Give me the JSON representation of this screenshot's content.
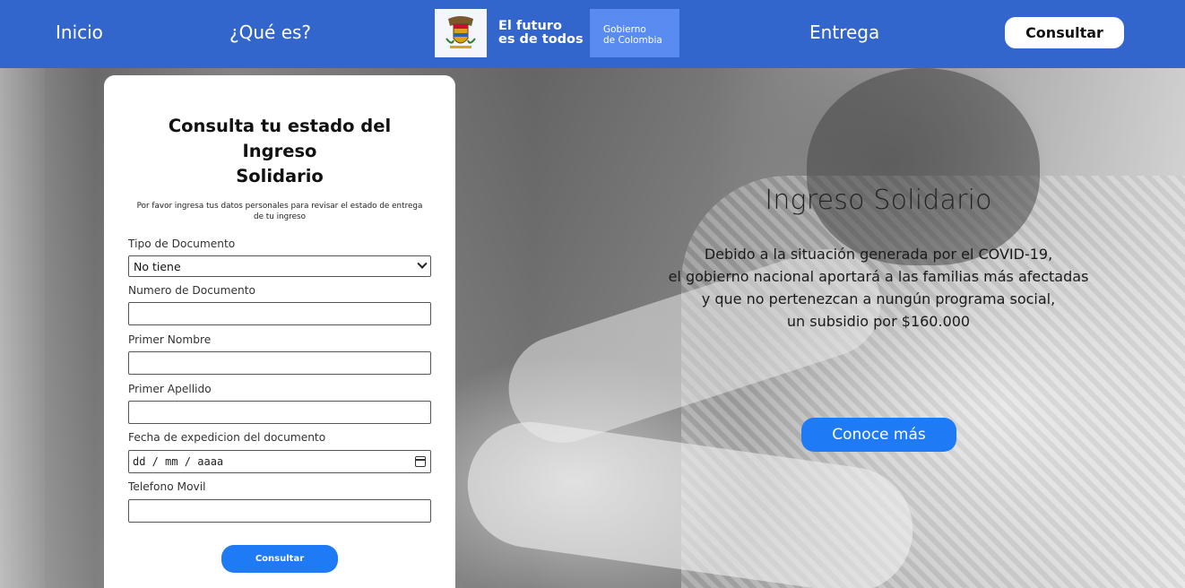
{
  "header": {
    "nav": {
      "inicio": "Inicio",
      "que_es": "¿Qué es?",
      "entrega": "Entrega"
    },
    "logo": {
      "slogan_line1": "El futuro",
      "slogan_line2": "es de todos",
      "gov_line1": "Gobierno",
      "gov_line2": "de Colombia"
    },
    "consultar_button": "Consultar",
    "bar_color": "#3366cc"
  },
  "hero": {
    "title": "Ingreso Solidario",
    "lines": [
      "Debido a la situación generada por el COVID-19,",
      "el gobierno nacional aportará a las familias más afectadas",
      "y que no pertenezcan a nungún programa social,",
      "un subsidio por $160.000"
    ],
    "cta_button": "Conoce más",
    "accent_color": "#1e7bf5"
  },
  "form": {
    "title_line1": "Consulta tu estado del",
    "title_line2": "Ingreso",
    "title_line3": "Solidario",
    "description": "Por favor ingresa tus datos personales para revisar el estado de entrega de tu ingreso",
    "fields": {
      "tipo_documento": {
        "label": "Tipo de Documento",
        "value": "No tiene"
      },
      "numero_documento": {
        "label": "Numero de Documento",
        "value": ""
      },
      "primer_nombre": {
        "label": "Primer Nombre",
        "value": ""
      },
      "primer_apellido": {
        "label": "Primer Apellido",
        "value": ""
      },
      "fecha_expedicion": {
        "label": "Fecha de expedicion del documento",
        "placeholder": "dd / mm / aaaa"
      },
      "telefono": {
        "label": "Telefono Movil",
        "value": ""
      }
    },
    "submit_button": "Consultar"
  }
}
